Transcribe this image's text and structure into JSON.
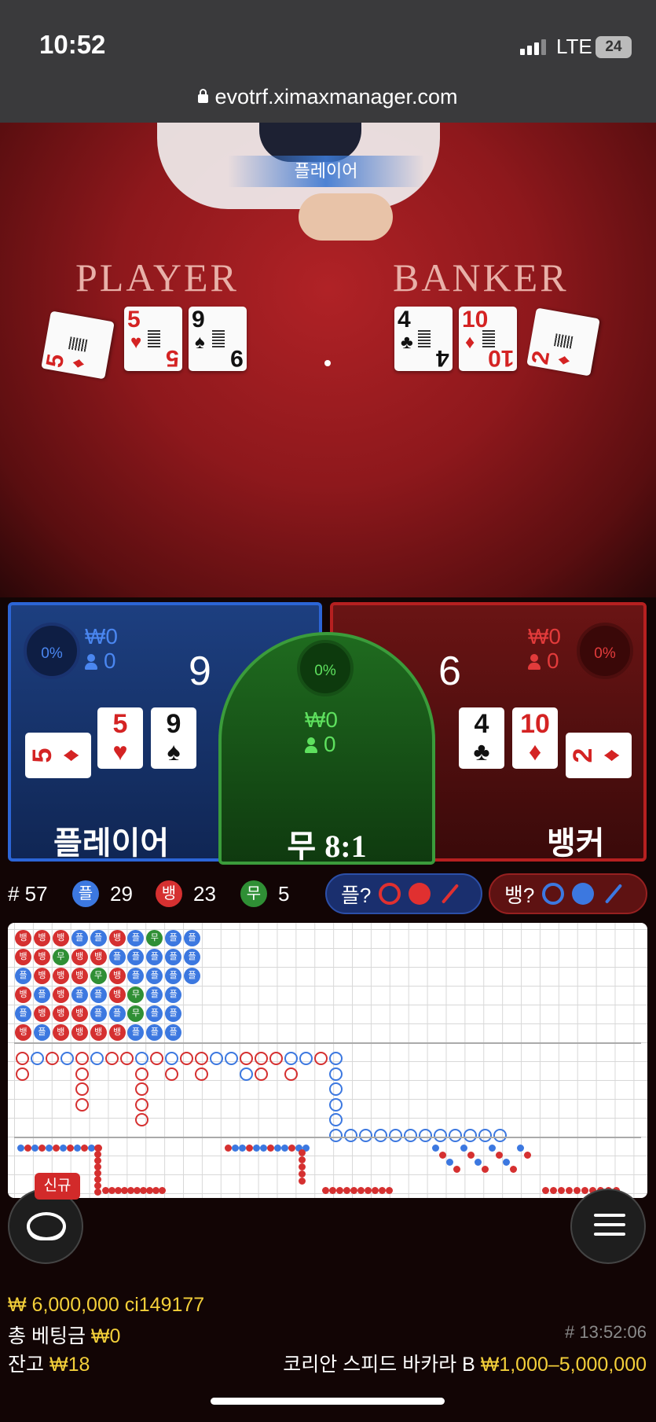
{
  "status": {
    "time": "10:52",
    "network": "LTE",
    "battery": "24"
  },
  "browser": {
    "url": "evotrf.ximaxmanager.com"
  },
  "video": {
    "winner_banner": "플레이어",
    "player_label": "PLAYER",
    "banker_label": "BANKER",
    "player_cards": [
      {
        "rank": "5",
        "suit": "♦"
      },
      {
        "rank": "5",
        "suit": "♥"
      },
      {
        "rank": "9",
        "suit": "♠"
      }
    ],
    "banker_cards": [
      {
        "rank": "4",
        "suit": "♣"
      },
      {
        "rank": "10",
        "suit": "♦"
      },
      {
        "rank": "2",
        "suit": "♦"
      }
    ]
  },
  "player": {
    "percent": "0%",
    "amount": "₩0",
    "users": "0",
    "score": "9",
    "name": "플레이어",
    "cards": [
      {
        "rank": "5",
        "suit": "♦"
      },
      {
        "rank": "5",
        "suit": "♥"
      },
      {
        "rank": "9",
        "suit": "♠"
      }
    ]
  },
  "tie": {
    "percent": "0%",
    "amount": "₩0",
    "users": "0",
    "name": "무",
    "odds": "8:1"
  },
  "banker": {
    "percent": "0%",
    "amount": "₩0",
    "users": "0",
    "score": "6",
    "name": "뱅커",
    "cards": [
      {
        "rank": "4",
        "suit": "♣"
      },
      {
        "rank": "10",
        "suit": "♦"
      },
      {
        "rank": "2",
        "suit": "♦"
      }
    ]
  },
  "stats": {
    "round": "# 57",
    "player_badge": "플",
    "player_count": "29",
    "banker_badge": "뱅",
    "banker_count": "23",
    "tie_badge": "무",
    "tie_count": "5",
    "player_ask": "플?",
    "banker_ask": "뱅?"
  },
  "roadmap": {
    "bead_rows": [
      [
        "뱅",
        "뱅",
        "뱅",
        "플",
        "플",
        "뱅",
        "플",
        "무",
        "플",
        "플"
      ],
      [
        "뱅",
        "뱅",
        "무",
        "뱅",
        "뱅",
        "플",
        "플",
        "플",
        "플",
        "플"
      ],
      [
        "플",
        "뱅",
        "뱅",
        "뱅",
        "무",
        "뱅",
        "플",
        "플",
        "플",
        "플"
      ],
      [
        "뱅",
        "플",
        "뱅",
        "플",
        "플",
        "뱅",
        "무",
        "플",
        "플",
        ""
      ],
      [
        "플",
        "뱅",
        "뱅",
        "뱅",
        "플",
        "플",
        "무",
        "플",
        "플",
        ""
      ],
      [
        "뱅",
        "플",
        "뱅",
        "뱅",
        "뱅",
        "뱅",
        "플",
        "플",
        "플",
        ""
      ]
    ],
    "colors": {
      "player": "#3c78e0",
      "banker": "#d53030",
      "tie": "#2f8f35"
    }
  },
  "bottom": {
    "new_badge": "신규",
    "limit_line": "₩ 6,000,000 ci149177",
    "total_bet_label": "총 베팅금",
    "total_bet": "₩0",
    "balance_label": "잔고",
    "balance": "₩18",
    "round_time": "# 13:52:06",
    "table_name": "코리안 스피드 바카라 B",
    "table_limits": "₩1,000–5,000,000"
  }
}
